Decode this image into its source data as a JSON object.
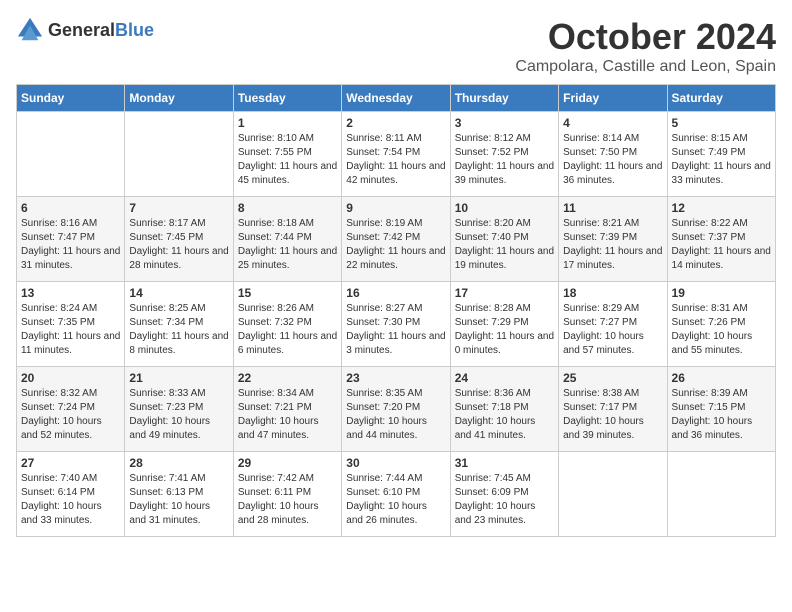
{
  "logo": {
    "general": "General",
    "blue": "Blue"
  },
  "header": {
    "month": "October 2024",
    "location": "Campolara, Castille and Leon, Spain"
  },
  "days_of_week": [
    "Sunday",
    "Monday",
    "Tuesday",
    "Wednesday",
    "Thursday",
    "Friday",
    "Saturday"
  ],
  "weeks": [
    [
      {
        "day": "",
        "info": ""
      },
      {
        "day": "",
        "info": ""
      },
      {
        "day": "1",
        "info": "Sunrise: 8:10 AM\nSunset: 7:55 PM\nDaylight: 11 hours and 45 minutes."
      },
      {
        "day": "2",
        "info": "Sunrise: 8:11 AM\nSunset: 7:54 PM\nDaylight: 11 hours and 42 minutes."
      },
      {
        "day": "3",
        "info": "Sunrise: 8:12 AM\nSunset: 7:52 PM\nDaylight: 11 hours and 39 minutes."
      },
      {
        "day": "4",
        "info": "Sunrise: 8:14 AM\nSunset: 7:50 PM\nDaylight: 11 hours and 36 minutes."
      },
      {
        "day": "5",
        "info": "Sunrise: 8:15 AM\nSunset: 7:49 PM\nDaylight: 11 hours and 33 minutes."
      }
    ],
    [
      {
        "day": "6",
        "info": "Sunrise: 8:16 AM\nSunset: 7:47 PM\nDaylight: 11 hours and 31 minutes."
      },
      {
        "day": "7",
        "info": "Sunrise: 8:17 AM\nSunset: 7:45 PM\nDaylight: 11 hours and 28 minutes."
      },
      {
        "day": "8",
        "info": "Sunrise: 8:18 AM\nSunset: 7:44 PM\nDaylight: 11 hours and 25 minutes."
      },
      {
        "day": "9",
        "info": "Sunrise: 8:19 AM\nSunset: 7:42 PM\nDaylight: 11 hours and 22 minutes."
      },
      {
        "day": "10",
        "info": "Sunrise: 8:20 AM\nSunset: 7:40 PM\nDaylight: 11 hours and 19 minutes."
      },
      {
        "day": "11",
        "info": "Sunrise: 8:21 AM\nSunset: 7:39 PM\nDaylight: 11 hours and 17 minutes."
      },
      {
        "day": "12",
        "info": "Sunrise: 8:22 AM\nSunset: 7:37 PM\nDaylight: 11 hours and 14 minutes."
      }
    ],
    [
      {
        "day": "13",
        "info": "Sunrise: 8:24 AM\nSunset: 7:35 PM\nDaylight: 11 hours and 11 minutes."
      },
      {
        "day": "14",
        "info": "Sunrise: 8:25 AM\nSunset: 7:34 PM\nDaylight: 11 hours and 8 minutes."
      },
      {
        "day": "15",
        "info": "Sunrise: 8:26 AM\nSunset: 7:32 PM\nDaylight: 11 hours and 6 minutes."
      },
      {
        "day": "16",
        "info": "Sunrise: 8:27 AM\nSunset: 7:30 PM\nDaylight: 11 hours and 3 minutes."
      },
      {
        "day": "17",
        "info": "Sunrise: 8:28 AM\nSunset: 7:29 PM\nDaylight: 11 hours and 0 minutes."
      },
      {
        "day": "18",
        "info": "Sunrise: 8:29 AM\nSunset: 7:27 PM\nDaylight: 10 hours and 57 minutes."
      },
      {
        "day": "19",
        "info": "Sunrise: 8:31 AM\nSunset: 7:26 PM\nDaylight: 10 hours and 55 minutes."
      }
    ],
    [
      {
        "day": "20",
        "info": "Sunrise: 8:32 AM\nSunset: 7:24 PM\nDaylight: 10 hours and 52 minutes."
      },
      {
        "day": "21",
        "info": "Sunrise: 8:33 AM\nSunset: 7:23 PM\nDaylight: 10 hours and 49 minutes."
      },
      {
        "day": "22",
        "info": "Sunrise: 8:34 AM\nSunset: 7:21 PM\nDaylight: 10 hours and 47 minutes."
      },
      {
        "day": "23",
        "info": "Sunrise: 8:35 AM\nSunset: 7:20 PM\nDaylight: 10 hours and 44 minutes."
      },
      {
        "day": "24",
        "info": "Sunrise: 8:36 AM\nSunset: 7:18 PM\nDaylight: 10 hours and 41 minutes."
      },
      {
        "day": "25",
        "info": "Sunrise: 8:38 AM\nSunset: 7:17 PM\nDaylight: 10 hours and 39 minutes."
      },
      {
        "day": "26",
        "info": "Sunrise: 8:39 AM\nSunset: 7:15 PM\nDaylight: 10 hours and 36 minutes."
      }
    ],
    [
      {
        "day": "27",
        "info": "Sunrise: 7:40 AM\nSunset: 6:14 PM\nDaylight: 10 hours and 33 minutes."
      },
      {
        "day": "28",
        "info": "Sunrise: 7:41 AM\nSunset: 6:13 PM\nDaylight: 10 hours and 31 minutes."
      },
      {
        "day": "29",
        "info": "Sunrise: 7:42 AM\nSunset: 6:11 PM\nDaylight: 10 hours and 28 minutes."
      },
      {
        "day": "30",
        "info": "Sunrise: 7:44 AM\nSunset: 6:10 PM\nDaylight: 10 hours and 26 minutes."
      },
      {
        "day": "31",
        "info": "Sunrise: 7:45 AM\nSunset: 6:09 PM\nDaylight: 10 hours and 23 minutes."
      },
      {
        "day": "",
        "info": ""
      },
      {
        "day": "",
        "info": ""
      }
    ]
  ]
}
